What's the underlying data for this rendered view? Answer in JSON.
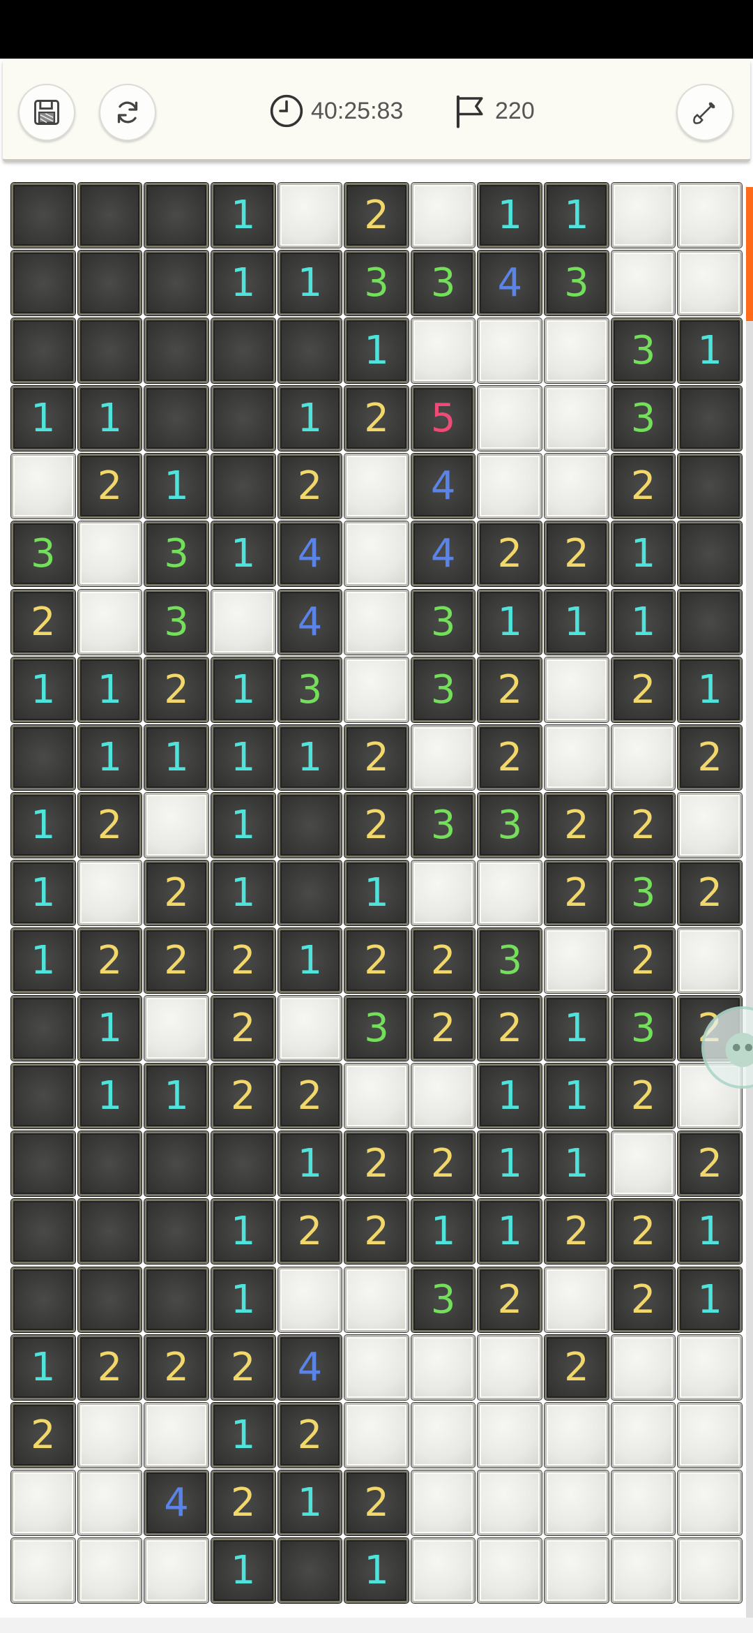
{
  "toolbar": {
    "timer": "40:25:83",
    "flags": "220",
    "icons": {
      "save": "save-icon",
      "restart": "refresh-icon",
      "clock": "clock-icon",
      "flag": "flag-icon",
      "shovel": "shovel-icon"
    }
  },
  "board": {
    "rows": [
      [
        "",
        "",
        "",
        "1",
        "#",
        "2",
        "#",
        "1",
        "1",
        "#",
        "#"
      ],
      [
        "",
        "",
        "",
        "1",
        "1",
        "3",
        "3",
        "4",
        "3",
        "#",
        "#"
      ],
      [
        "",
        "",
        "",
        "",
        "",
        "1",
        "#",
        "#",
        "#",
        "3",
        "1"
      ],
      [
        "1",
        "1",
        "",
        "",
        "1",
        "2",
        "5",
        "#",
        "#",
        "3",
        ""
      ],
      [
        "#",
        "2",
        "1",
        "",
        "2",
        "#",
        "4",
        "#",
        "#",
        "2",
        ""
      ],
      [
        "3",
        "#",
        "3",
        "1",
        "4",
        "#",
        "4",
        "2",
        "2",
        "1",
        ""
      ],
      [
        "2",
        "#",
        "3",
        "#",
        "4",
        "#",
        "3",
        "1",
        "1",
        "1",
        ""
      ],
      [
        "1",
        "1",
        "2",
        "1",
        "3",
        "#",
        "3",
        "2",
        "#",
        "2",
        "1"
      ],
      [
        "",
        "1",
        "1",
        "1",
        "1",
        "2",
        "#",
        "2",
        "#",
        "#",
        "2"
      ],
      [
        "1",
        "2",
        "#",
        "1",
        "",
        "2",
        "3",
        "3",
        "2",
        "2",
        "#"
      ],
      [
        "1",
        "#",
        "2",
        "1",
        "",
        "1",
        "#",
        "#",
        "2",
        "3",
        "2"
      ],
      [
        "1",
        "2",
        "2",
        "2",
        "1",
        "2",
        "2",
        "3",
        "#",
        "2",
        "#"
      ],
      [
        "",
        "1",
        "#",
        "2",
        "#",
        "3",
        "2",
        "2",
        "1",
        "3",
        "2"
      ],
      [
        "",
        "1",
        "1",
        "2",
        "2",
        "#",
        "#",
        "1",
        "1",
        "2",
        "#"
      ],
      [
        "",
        "",
        "",
        "",
        "1",
        "2",
        "2",
        "1",
        "1",
        "#",
        "2"
      ],
      [
        "",
        "",
        "",
        "1",
        "2",
        "2",
        "1",
        "1",
        "2",
        "2",
        "1"
      ],
      [
        "",
        "",
        "",
        "1",
        "#",
        "#",
        "3",
        "2",
        "#",
        "2",
        "1"
      ],
      [
        "1",
        "2",
        "2",
        "2",
        "4",
        "#",
        "#",
        "#",
        "2",
        "#",
        "#"
      ],
      [
        "2",
        "#",
        "#",
        "1",
        "2",
        "#",
        "#",
        "#",
        "#",
        "#",
        "#"
      ],
      [
        "#",
        "#",
        "4",
        "2",
        "1",
        "2",
        "#",
        "#",
        "#",
        "#",
        "#"
      ],
      [
        "#",
        "#",
        "#",
        "1",
        "",
        "1",
        "#",
        "#",
        "#",
        "#",
        "#"
      ]
    ]
  },
  "colors": {
    "n1": "#4fe3dc",
    "n2": "#f2d86b",
    "n3": "#74df5a",
    "n4": "#5b84e8",
    "n5": "#f04a76",
    "scroll_accent": "#ff6a1a"
  }
}
